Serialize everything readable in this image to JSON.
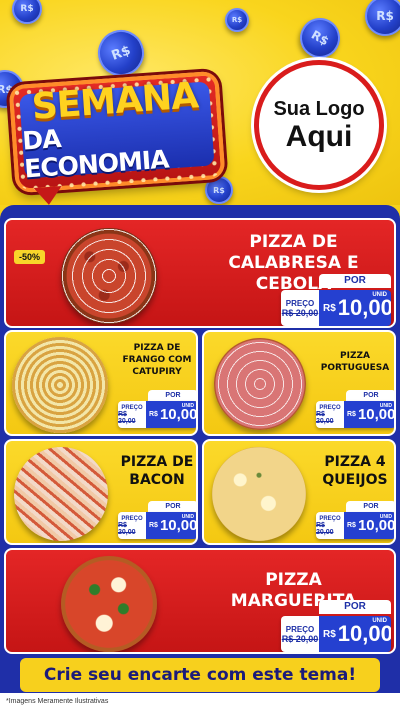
{
  "header": {
    "banner_line1": "SEMANA",
    "banner_line2": "DA ECONOMIA",
    "logo_line1": "Sua Logo",
    "logo_line2": "Aqui",
    "coin_symbol": "R$"
  },
  "products": [
    {
      "name": "PIZZA DE CALABRESA E CEBOLA",
      "discount": "-50%",
      "por": "POR",
      "preco_label": "PREÇO",
      "old_price": "R$ 20,00",
      "currency": "R$",
      "price": "10,00",
      "unit": "UNID"
    },
    {
      "name": "PIZZA DE FRANGO COM CATUPIRY",
      "por": "POR",
      "preco_label": "PREÇO",
      "old_price": "R$ 20,00",
      "currency": "R$",
      "price": "10,00",
      "unit": "UNID"
    },
    {
      "name": "PIZZA PORTUGUESA",
      "por": "POR",
      "preco_label": "PREÇO",
      "old_price": "R$ 20,00",
      "currency": "R$",
      "price": "10,00",
      "unit": "UNID"
    },
    {
      "name": "PIZZA DE BACON",
      "por": "POR",
      "preco_label": "PREÇO",
      "old_price": "R$ 20,00",
      "currency": "R$",
      "price": "10,00",
      "unit": "UNID"
    },
    {
      "name": "PIZZA 4 QUEIJOS",
      "por": "POR",
      "preco_label": "PREÇO",
      "old_price": "R$ 20,00",
      "currency": "R$",
      "price": "10,00",
      "unit": "UNID"
    },
    {
      "name": "PIZZA MARGUERITA",
      "por": "POR",
      "preco_label": "PREÇO",
      "old_price": "R$ 20,00",
      "currency": "R$",
      "price": "10,00",
      "unit": "UNID"
    }
  ],
  "cta": "Crie seu encarte com este tema!",
  "footer": "*Imagens Meramente Ilustrativas",
  "colors": {
    "yellow": "#f6d21c",
    "red": "#e42626",
    "blue": "#1f2fa8",
    "price_blue": "#2540d0"
  }
}
